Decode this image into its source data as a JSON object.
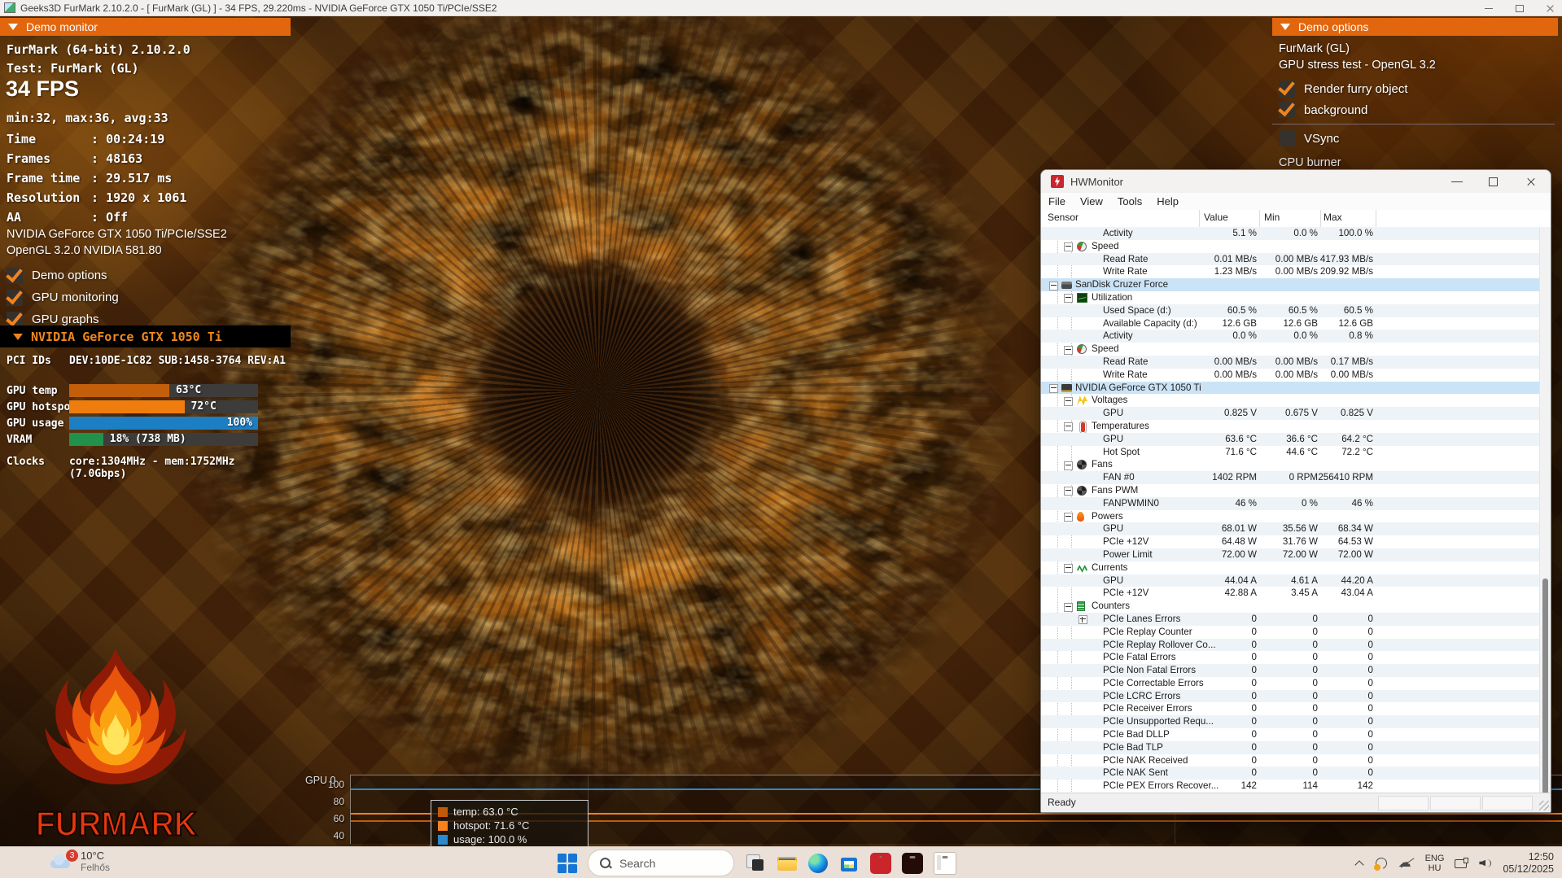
{
  "window": {
    "title": "Geeks3D FurMark 2.10.2.0 - [ FurMark (GL) ] - 34 FPS, 29.220ms - NVIDIA GeForce GTX 1050 Ti/PCIe/SSE2"
  },
  "demo_monitor": {
    "header": "Demo monitor",
    "app": "FurMark (64-bit) 2.10.2.0",
    "test": "Test: FurMark (GL)",
    "fps": "34 FPS",
    "fps_minmax": "min:32, max:36, avg:33",
    "stats": [
      {
        "label": "Time",
        "value": "00:24:19"
      },
      {
        "label": "Frames",
        "value": "48163"
      },
      {
        "label": "Frame time",
        "value": "29.517 ms"
      },
      {
        "label": "Resolution",
        "value": "1920 x 1061"
      },
      {
        "label": "AA",
        "value": "Off"
      }
    ],
    "gpu_name": "NVIDIA GeForce GTX 1050 Ti/PCIe/SSE2",
    "api": "OpenGL 3.2.0 NVIDIA 581.80",
    "toggles": [
      {
        "label": "Demo options",
        "checked": true
      },
      {
        "label": "GPU monitoring",
        "checked": true
      },
      {
        "label": "GPU graphs",
        "checked": true
      }
    ],
    "gpu_panel": {
      "header": "NVIDIA GeForce GTX 1050 Ti",
      "pci_label": "PCI IDs",
      "pci_value": "DEV:10DE-1C82 SUB:1458-3764 REV:A1",
      "meters": [
        {
          "label": "GPU temp",
          "text": "63°C",
          "pct": 53,
          "color": "#c35f0b"
        },
        {
          "label": "GPU hotspot",
          "text": "72°C",
          "pct": 61,
          "color": "#ef7d0e"
        },
        {
          "label": "GPU usage",
          "text": "100%",
          "pct": 100,
          "color": "#1c7fc4",
          "align": "in"
        },
        {
          "label": "VRAM",
          "text": "18% (738 MB)",
          "pct": 18,
          "color": "#21914b"
        }
      ],
      "clocks_label": "Clocks",
      "clocks_value": "core:1304MHz - mem:1752MHz (7.0Gbps)"
    }
  },
  "demo_options": {
    "header": "Demo options",
    "name": "FurMark (GL)",
    "desc": "GPU stress test - OpenGL 3.2",
    "toggles": [
      {
        "label": "Render furry object",
        "checked": true
      },
      {
        "label": "background",
        "checked": true
      }
    ],
    "vsync": {
      "label": "VSync",
      "checked": false
    },
    "clipped": "CPU burner"
  },
  "hwmonitor": {
    "title": "HWMonitor",
    "menu": [
      "File",
      "View",
      "Tools",
      "Help"
    ],
    "columns": [
      "Sensor",
      "Value",
      "Min",
      "Max"
    ],
    "status": "Ready",
    "rows": [
      {
        "label": "Activity",
        "value": "5.1 %",
        "min": "0.0 %",
        "max": "100.0 %",
        "type": "leaf",
        "shaded": true
      },
      {
        "label": "Speed",
        "value": "",
        "min": "",
        "max": "",
        "type": "group",
        "icon": "gauge"
      },
      {
        "label": "Read Rate",
        "value": "0.01 MB/s",
        "min": "0.00 MB/s",
        "max": "417.93 MB/s",
        "type": "leaf",
        "shaded": true
      },
      {
        "label": "Write Rate",
        "value": "1.23 MB/s",
        "min": "0.00 MB/s",
        "max": "209.92 MB/s",
        "type": "leaf"
      },
      {
        "label": "SanDisk Cruzer Force",
        "value": "",
        "min": "",
        "max": "",
        "type": "device",
        "icon": "drive"
      },
      {
        "label": "Utilization",
        "value": "",
        "min": "",
        "max": "",
        "type": "group",
        "icon": "activity"
      },
      {
        "label": "Used Space (d:)",
        "value": "60.5 %",
        "min": "60.5 %",
        "max": "60.5 %",
        "type": "leaf",
        "shaded": true
      },
      {
        "label": "Available Capacity (d:)",
        "value": "12.6 GB",
        "min": "12.6 GB",
        "max": "12.6 GB",
        "type": "leaf"
      },
      {
        "label": "Activity",
        "value": "0.0 %",
        "min": "0.0 %",
        "max": "0.8 %",
        "type": "leaf",
        "shaded": true
      },
      {
        "label": "Speed",
        "value": "",
        "min": "",
        "max": "",
        "type": "group",
        "icon": "gauge"
      },
      {
        "label": "Read Rate",
        "value": "0.00 MB/s",
        "min": "0.00 MB/s",
        "max": "0.17 MB/s",
        "type": "leaf",
        "shaded": true
      },
      {
        "label": "Write Rate",
        "value": "0.00 MB/s",
        "min": "0.00 MB/s",
        "max": "0.00 MB/s",
        "type": "leaf"
      },
      {
        "label": "NVIDIA GeForce GTX 1050 Ti",
        "value": "",
        "min": "",
        "max": "",
        "type": "device",
        "icon": "gpu"
      },
      {
        "label": "Voltages",
        "value": "",
        "min": "",
        "max": "",
        "type": "group",
        "icon": "voltage"
      },
      {
        "label": "GPU",
        "value": "0.825 V",
        "min": "0.675 V",
        "max": "0.825 V",
        "type": "leaf",
        "shaded": true
      },
      {
        "label": "Temperatures",
        "value": "",
        "min": "",
        "max": "",
        "type": "group",
        "icon": "thermo"
      },
      {
        "label": "GPU",
        "value": "63.6 °C",
        "min": "36.6 °C",
        "max": "64.2 °C",
        "type": "leaf",
        "shaded": true
      },
      {
        "label": "Hot Spot",
        "value": "71.6 °C",
        "min": "44.6 °C",
        "max": "72.2 °C",
        "type": "leaf"
      },
      {
        "label": "Fans",
        "value": "",
        "min": "",
        "max": "",
        "type": "group",
        "icon": "fan"
      },
      {
        "label": "FAN #0",
        "value": "1402 RPM",
        "min": "0 RPM",
        "max": "256410 RPM",
        "type": "leaf",
        "shaded": true
      },
      {
        "label": "Fans PWM",
        "value": "",
        "min": "",
        "max": "",
        "type": "group",
        "icon": "fan"
      },
      {
        "label": "FANPWMIN0",
        "value": "46 %",
        "min": "0 %",
        "max": "46 %",
        "type": "leaf",
        "shaded": true
      },
      {
        "label": "Powers",
        "value": "",
        "min": "",
        "max": "",
        "type": "group",
        "icon": "flame"
      },
      {
        "label": "GPU",
        "value": "68.01 W",
        "min": "35.56 W",
        "max": "68.34 W",
        "type": "leaf",
        "shaded": true
      },
      {
        "label": "PCIe +12V",
        "value": "64.48 W",
        "min": "31.76 W",
        "max": "64.53 W",
        "type": "leaf"
      },
      {
        "label": "Power Limit",
        "value": "72.00 W",
        "min": "72.00 W",
        "max": "72.00 W",
        "type": "leaf",
        "shaded": true
      },
      {
        "label": "Currents",
        "value": "",
        "min": "",
        "max": "",
        "type": "group",
        "icon": "current"
      },
      {
        "label": "GPU",
        "value": "44.04 A",
        "min": "4.61 A",
        "max": "44.20 A",
        "type": "leaf",
        "shaded": true
      },
      {
        "label": "PCIe +12V",
        "value": "42.88 A",
        "min": "3.45 A",
        "max": "43.04 A",
        "type": "leaf"
      },
      {
        "label": "Counters",
        "value": "",
        "min": "",
        "max": "",
        "type": "group",
        "icon": "counter"
      },
      {
        "label": "PCIe Lanes Errors",
        "value": "0",
        "min": "0",
        "max": "0",
        "type": "leaf",
        "shaded": true,
        "plus": true
      },
      {
        "label": "PCIe Replay Counter",
        "value": "0",
        "min": "0",
        "max": "0",
        "type": "leaf"
      },
      {
        "label": "PCIe Replay Rollover Co...",
        "value": "0",
        "min": "0",
        "max": "0",
        "type": "leaf",
        "shaded": true
      },
      {
        "label": "PCIe Fatal Errors",
        "value": "0",
        "min": "0",
        "max": "0",
        "type": "leaf"
      },
      {
        "label": "PCIe Non Fatal Errors",
        "value": "0",
        "min": "0",
        "max": "0",
        "type": "leaf",
        "shaded": true
      },
      {
        "label": "PCIe Correctable Errors",
        "value": "0",
        "min": "0",
        "max": "0",
        "type": "leaf"
      },
      {
        "label": "PCIe LCRC Errors",
        "value": "0",
        "min": "0",
        "max": "0",
        "type": "leaf",
        "shaded": true
      },
      {
        "label": "PCIe Receiver Errors",
        "value": "0",
        "min": "0",
        "max": "0",
        "type": "leaf"
      },
      {
        "label": "PCIe Unsupported Requ...",
        "value": "0",
        "min": "0",
        "max": "0",
        "type": "leaf",
        "shaded": true
      },
      {
        "label": "PCIe Bad DLLP",
        "value": "0",
        "min": "0",
        "max": "0",
        "type": "leaf"
      },
      {
        "label": "PCIe Bad TLP",
        "value": "0",
        "min": "0",
        "max": "0",
        "type": "leaf",
        "shaded": true
      },
      {
        "label": "PCIe NAK Received",
        "value": "0",
        "min": "0",
        "max": "0",
        "type": "leaf"
      },
      {
        "label": "PCIe NAK Sent",
        "value": "0",
        "min": "0",
        "max": "0",
        "type": "leaf",
        "shaded": true
      },
      {
        "label": "PCIe PEX Errors Recover...",
        "value": "142",
        "min": "114",
        "max": "142",
        "type": "leaf"
      }
    ]
  },
  "gpu_graph": {
    "type": "line",
    "label": "GPU 0",
    "ticks": [
      "100",
      "80",
      "60",
      "40"
    ],
    "ylim": [
      40,
      100
    ],
    "series": [
      {
        "name": "temp",
        "legend": "temp: 63.0 °C",
        "value": 63.0,
        "color": "#c2590a"
      },
      {
        "name": "hotspot",
        "legend": "hotspot: 71.6 °C",
        "value": 71.6,
        "color": "#f5821e"
      },
      {
        "name": "usage",
        "legend": "usage: 100.0 %",
        "value": 100.0,
        "color": "#2d89cc"
      }
    ]
  },
  "logo": {
    "text": "FURMARK"
  },
  "taskbar": {
    "weather": {
      "badge": "3",
      "temp": "10°C",
      "cond": "Felhős"
    },
    "search": "Search",
    "tray": {
      "lang_top": "ENG",
      "lang_bottom": "HU",
      "time": "12:50",
      "date": "05/12/2025"
    }
  }
}
